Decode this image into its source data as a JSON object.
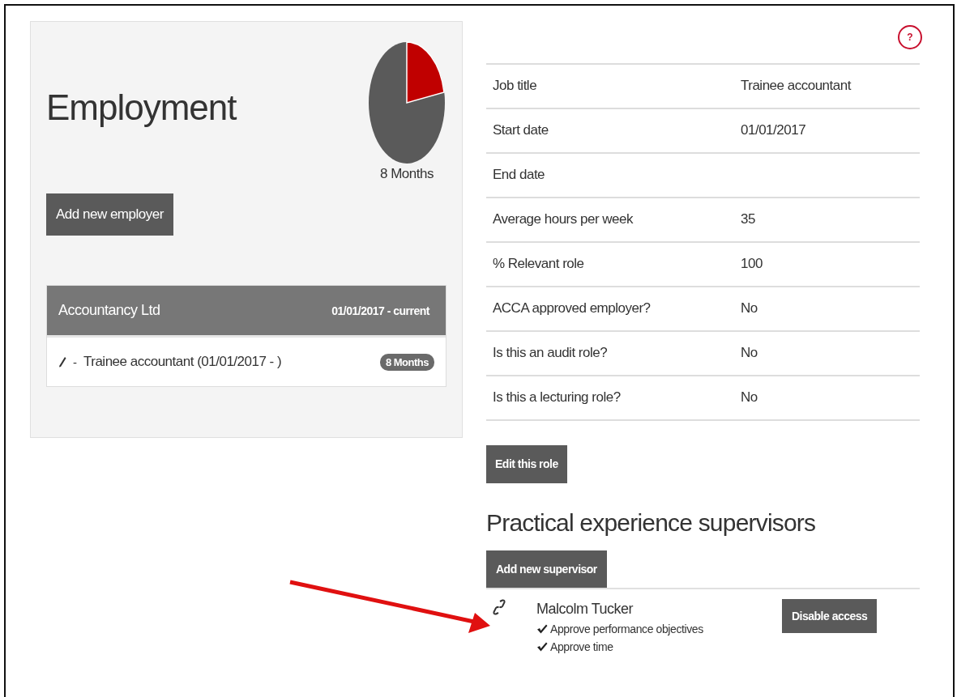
{
  "employment": {
    "title": "Employment",
    "chart_label": "8 Months",
    "add_button": "Add new employer",
    "employers": [
      {
        "name": "Accountancy Ltd",
        "period": "01/01/2017 - current",
        "roles": [
          {
            "separator": "-",
            "title": "Trainee accountant (01/01/2017 - )",
            "duration": "8 Months"
          }
        ]
      }
    ]
  },
  "help": {
    "label": "?"
  },
  "role_details": [
    {
      "label": "Job title",
      "value": "Trainee accountant"
    },
    {
      "label": "Start date",
      "value": "01/01/2017"
    },
    {
      "label": "End date"
    },
    {
      "label": "Average hours per week",
      "value": "35"
    },
    {
      "label": "% Relevant role",
      "value": "100"
    },
    {
      "label": "ACCA approved employer?",
      "value": "No"
    },
    {
      "label": "Is this an audit role?",
      "value": "No"
    },
    {
      "label": "Is this a lecturing role?",
      "value": "No"
    }
  ],
  "edit_button": "Edit this role",
  "supervisors_section": {
    "title": "Practical experience supervisors",
    "add_button": "Add new supervisor",
    "supervisors": [
      {
        "name": "Malcolm Tucker",
        "action": "Disable access",
        "permissions": [
          {
            "label": "Approve performance objectives",
            "granted": true
          },
          {
            "label": "Approve time",
            "granted": true
          }
        ]
      }
    ]
  }
}
